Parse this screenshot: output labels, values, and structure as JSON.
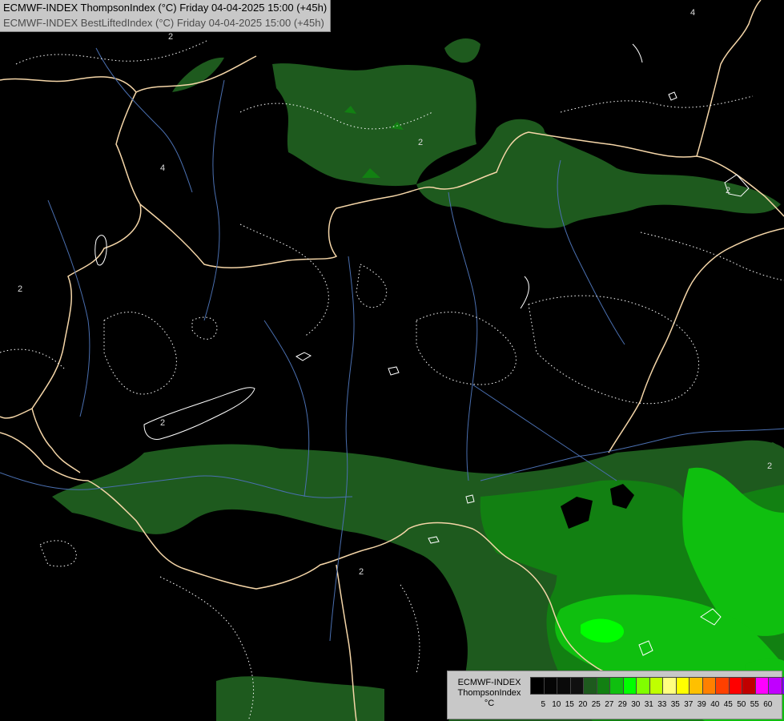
{
  "header": {
    "line1": "ECMWF-INDEX ThompsonIndex (°C) Friday 04-04-2025 15:00 (+45h)",
    "line2": "ECMWF-INDEX BestLiftedIndex (°C) Friday 04-04-2025 15:00 (+45h)"
  },
  "legend": {
    "model": "ECMWF-INDEX",
    "parameter": "ThompsonIndex",
    "unit": "°C",
    "colors": [
      "#000000",
      "#050505",
      "#0a0a0a",
      "#101010",
      "#1e5a1e",
      "#128012",
      "#0fbf0f",
      "#00ff00",
      "#80ff00",
      "#c0ff00",
      "#ffff80",
      "#ffff00",
      "#ffc000",
      "#ff8000",
      "#ff4000",
      "#ff0000",
      "#c00000",
      "#ff00ff",
      "#c000ff",
      "#8000ff",
      "#4000ff",
      "#0000ff"
    ],
    "ticks": [
      "5",
      "10",
      "15",
      "20",
      "25",
      "27",
      "29",
      "30",
      "31",
      "33",
      "35",
      "37",
      "39",
      "40",
      "45",
      "50",
      "55",
      "60"
    ]
  },
  "contour_labels": [
    "2",
    "4",
    "2",
    "4",
    "2",
    "2",
    "2",
    "2",
    "2"
  ],
  "map": {
    "background": "#000000",
    "field_colors": {
      "dark_green": "#1e5a1e",
      "mid_green": "#128012",
      "bright_green": "#0fbf0f",
      "lime": "#00ff00"
    },
    "border_color": "#f5d6a8",
    "river_color": "#4a6fb0",
    "contour_color": "#ffffff"
  }
}
